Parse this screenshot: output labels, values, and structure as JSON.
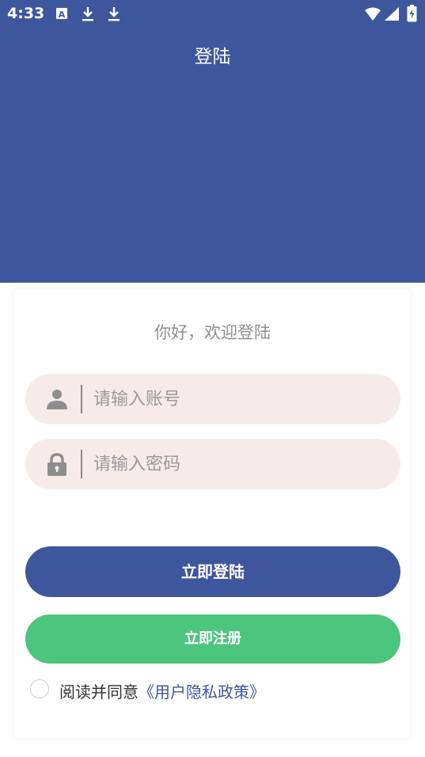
{
  "colors": {
    "primary": "#3e579c",
    "secondary": "#4cc57f",
    "link": "#3e579c",
    "field_bg": "#f5ece9"
  },
  "status_bar": {
    "time": "4:33",
    "icons": [
      "font-notification-icon",
      "download-icon",
      "download-icon",
      "wifi-icon",
      "cellular-signal-icon",
      "battery-charging-icon"
    ]
  },
  "header": {
    "title": "登陆"
  },
  "login_card": {
    "greeting": "你好，欢迎登陆",
    "account_field": {
      "placeholder": "请输入账号",
      "value": "",
      "icon": "user-icon"
    },
    "password_field": {
      "placeholder": "请输入密码",
      "value": "",
      "icon": "lock-icon"
    },
    "login_button_label": "立即登陆",
    "register_button_label": "立即注册",
    "agreement": {
      "checked": false,
      "text": "阅读并同意",
      "link_text": "《用户隐私政策》"
    }
  }
}
